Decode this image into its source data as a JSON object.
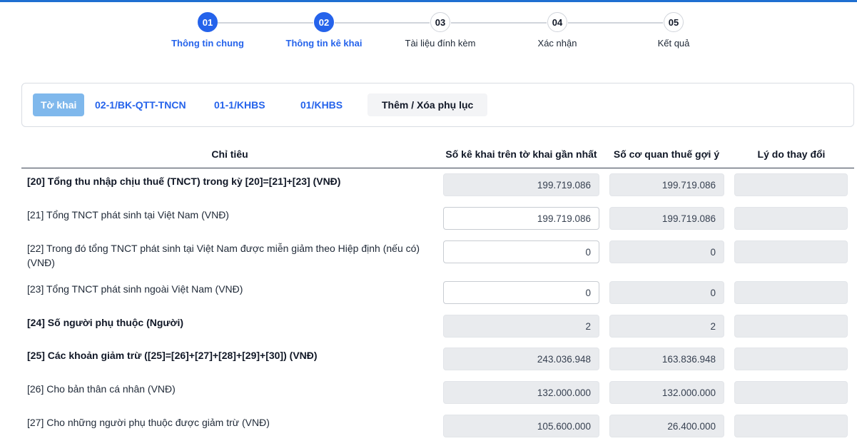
{
  "stepper": {
    "steps": [
      {
        "number": "01",
        "label": "Thông tin chung",
        "state": "active"
      },
      {
        "number": "02",
        "label": "Thông tin kê khai",
        "state": "active"
      },
      {
        "number": "03",
        "label": "Tài liệu đính kèm",
        "state": "inactive"
      },
      {
        "number": "04",
        "label": "Xác nhận",
        "state": "inactive"
      },
      {
        "number": "05",
        "label": "Kết quả",
        "state": "inactive"
      }
    ]
  },
  "tabs": {
    "items": [
      "Tờ khai",
      "02-1/BK-QTT-TNCN",
      "01-1/KHBS",
      "01/KHBS"
    ],
    "selected": "Tờ khai",
    "add_remove_label": "Thêm / Xóa phụ lục"
  },
  "table": {
    "headers": {
      "indicator": "Chỉ tiêu",
      "declared": "Số kê khai trên tờ khai gần nhất",
      "suggested": "Số cơ quan thuế gợi ý",
      "reason": "Lý do thay đổi"
    },
    "rows": [
      {
        "label": "[20] Tổng thu nhập chịu thuế (TNCT) trong kỳ [20]=[21]+[23] (VNĐ)",
        "bold": true,
        "declared": "199.719.086",
        "declared_editable": false,
        "suggested": "199.719.086",
        "reason": ""
      },
      {
        "label": "[21] Tổng TNCT phát sinh tại Việt Nam (VNĐ)",
        "bold": false,
        "declared": "199.719.086",
        "declared_editable": true,
        "suggested": "199.719.086",
        "reason": ""
      },
      {
        "label": "[22] Trong đó tổng TNCT phát sinh tại Việt Nam được miễn giảm theo Hiệp định (nếu có) (VNĐ)",
        "bold": false,
        "declared": "0",
        "declared_editable": true,
        "suggested": "0",
        "reason": ""
      },
      {
        "label": "[23] Tổng TNCT phát sinh ngoài Việt Nam (VNĐ)",
        "bold": false,
        "declared": "0",
        "declared_editable": true,
        "suggested": "0",
        "reason": ""
      },
      {
        "label": "[24] Số người phụ thuộc (Người)",
        "bold": true,
        "declared": "2",
        "declared_editable": false,
        "suggested": "2",
        "reason": ""
      },
      {
        "label": "[25] Các khoản giảm trừ ([25]=[26]+[27]+[28]+[29]+[30]) (VNĐ)",
        "bold": true,
        "declared": "243.036.948",
        "declared_editable": false,
        "suggested": "163.836.948",
        "reason": ""
      },
      {
        "label": "[26] Cho bản thân cá nhân (VNĐ)",
        "bold": false,
        "declared": "132.000.000",
        "declared_editable": false,
        "suggested": "132.000.000",
        "reason": ""
      },
      {
        "label": "[27] Cho những người phụ thuộc được giảm trừ (VNĐ)",
        "bold": false,
        "declared": "105.600.000",
        "declared_editable": false,
        "suggested": "26.400.000",
        "reason": ""
      }
    ]
  },
  "colors": {
    "accent": "#2563eb",
    "tab_selected_bg": "#7fb8ec",
    "readonly_bg": "#e9ebee",
    "top_bar": "#1f6fd1"
  }
}
